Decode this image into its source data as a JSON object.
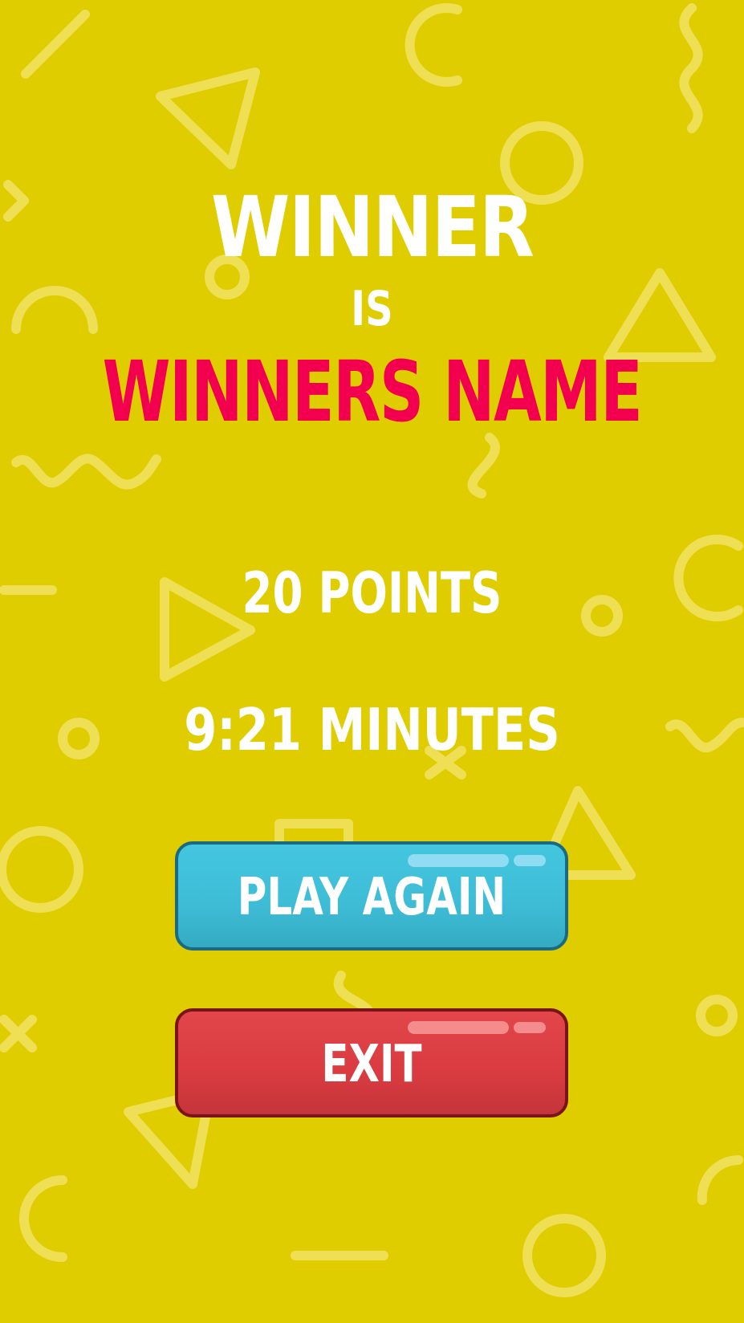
{
  "result": {
    "winner_label": "WINNER",
    "is_label": "IS",
    "winner_name": "WINNERS NAME",
    "points": "20 POINTS",
    "time": "9:21 MINUTES"
  },
  "buttons": {
    "play_again": "PLAY AGAIN",
    "exit": "EXIT"
  },
  "colors": {
    "background": "#dfcd00",
    "pattern": "#efdf55",
    "winner_name": "#f2004f",
    "play_again_button": "#3ebcd6",
    "exit_button": "#d93b40"
  }
}
